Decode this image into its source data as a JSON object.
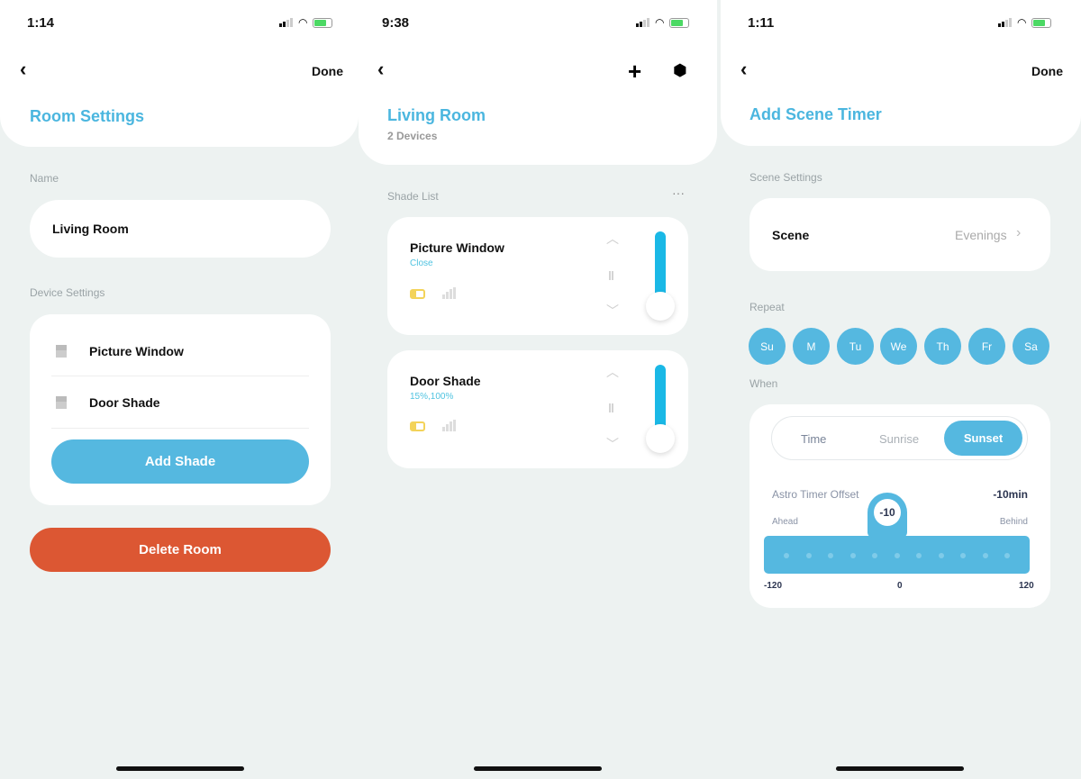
{
  "colors": {
    "accent": "#4bb6df",
    "button": "#55b8e0",
    "danger": "#dc5733",
    "slider": "#1ab8e6",
    "battery_low": "#f3d35a"
  },
  "room_settings": {
    "status_time": "1:14",
    "done": "Done",
    "title": "Room Settings",
    "name_label": "Name",
    "name_value": "Living Room",
    "device_settings_label": "Device Settings",
    "devices": [
      {
        "name": "Picture Window",
        "icon": "shade-icon"
      },
      {
        "name": "Door Shade",
        "icon": "shade-icon"
      }
    ],
    "add_shade": "Add Shade",
    "delete_room": "Delete Room"
  },
  "living_room": {
    "status_time": "9:38",
    "title": "Living Room",
    "subtitle": "2 Devices",
    "list_label": "Shade List",
    "more": "···",
    "shades": [
      {
        "name": "Picture Window",
        "status": "Close",
        "position_percent": 0
      },
      {
        "name": "Door Shade",
        "status": "15%,100%",
        "position_percent": 15
      }
    ]
  },
  "scene_timer": {
    "status_time": "1:11",
    "done": "Done",
    "title": "Add Scene Timer",
    "scene_settings_label": "Scene Settings",
    "scene_label": "Scene",
    "scene_value": "Evenings",
    "repeat_label": "Repeat",
    "days": [
      "Su",
      "M",
      "Tu",
      "We",
      "Th",
      "Fr",
      "Sa"
    ],
    "when_label": "When",
    "modes": [
      "Time",
      "Sunrise",
      "Sunset"
    ],
    "selected_mode": "Sunset",
    "offset_label": "Astro Timer Offset",
    "offset_value": "-10min",
    "knob_value": "-10",
    "ahead": "Ahead",
    "behind": "Behind",
    "min": "-120",
    "mid": "0",
    "max": "120"
  }
}
